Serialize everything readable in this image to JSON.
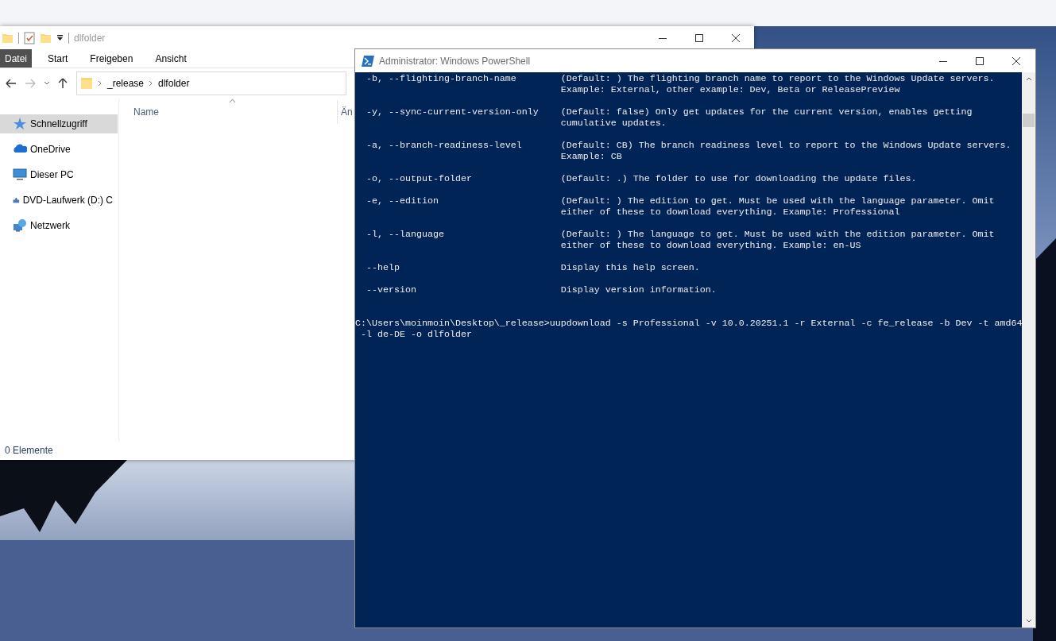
{
  "explorer": {
    "title": "dlfolder",
    "ribbon_tabs": [
      {
        "label": "Datei",
        "selected": true
      },
      {
        "label": "Start",
        "selected": false
      },
      {
        "label": "Freigeben",
        "selected": false
      },
      {
        "label": "Ansicht",
        "selected": false
      }
    ],
    "breadcrumb": [
      "_release",
      "dlfolder"
    ],
    "nav_items": [
      {
        "label": "Schnellzugriff",
        "selected": true,
        "kind": "star"
      },
      {
        "label": "OneDrive",
        "selected": false,
        "kind": "cloud"
      },
      {
        "label": "Dieser PC",
        "selected": false,
        "kind": "pc"
      },
      {
        "label": "DVD-Laufwerk (D:) C",
        "selected": false,
        "kind": "dvd"
      },
      {
        "label": "Netzwerk",
        "selected": false,
        "kind": "network"
      }
    ],
    "columns": [
      "Name",
      "Än"
    ],
    "status": "0 Elemente"
  },
  "powershell": {
    "title": "Administrator: Windows PowerShell",
    "options": [
      {
        "flag": "-b, --flighting-branch-name",
        "description": [
          "(Default: ) The flighting branch name to report to the Windows Update servers.",
          "Example: External, other example: Dev, Beta or ReleasePreview"
        ]
      },
      {
        "flag": "-y, --sync-current-version-only",
        "description": [
          "(Default: false) Only get updates for the current version, enables getting",
          "cumulative updates."
        ]
      },
      {
        "flag": "-a, --branch-readiness-level",
        "description": [
          "(Default: CB) The branch readiness level to report to the Windows Update servers.",
          "Example: CB"
        ]
      },
      {
        "flag": "-o, --output-folder",
        "description": [
          "(Default: .) The folder to use for downloading the update files."
        ]
      },
      {
        "flag": "-e, --edition",
        "description": [
          "(Default: ) The edition to get. Must be used with the language parameter. Omit",
          "either of these to download everything. Example: Professional"
        ]
      },
      {
        "flag": "-l, --language",
        "description": [
          "(Default: ) The language to get. Must be used with the edition parameter. Omit",
          "either of these to download everything. Example: en-US"
        ]
      },
      {
        "flag": "--help",
        "description": [
          "Display this help screen."
        ]
      },
      {
        "flag": "--version",
        "description": [
          "Display version information."
        ]
      }
    ],
    "command": [
      "C:\\Users\\moinmoin\\Desktop\\_release>uupdownload -s Professional -v 10.0.20251.1 -r External -c fe_release -b Dev -t amd64",
      "-l de-DE -o dlfolder"
    ]
  }
}
